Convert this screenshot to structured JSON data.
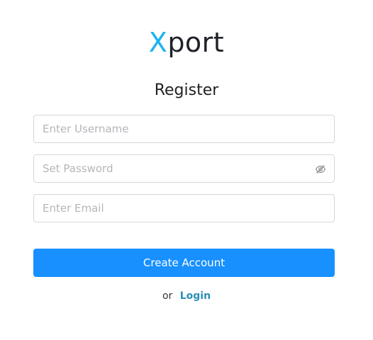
{
  "brand": {
    "accent_letter": "X",
    "rest": "port"
  },
  "form": {
    "title": "Register",
    "username": {
      "placeholder": "Enter Username",
      "value": ""
    },
    "password": {
      "placeholder": "Set Password",
      "value": "",
      "toggle_icon": "eye-slash-icon"
    },
    "email": {
      "placeholder": "Enter Email",
      "value": ""
    },
    "submit_label": "Create Account"
  },
  "footer": {
    "or_text": "or",
    "login_label": "Login"
  },
  "colors": {
    "accent": "#1ab3f0",
    "primary": "#1890ff",
    "link": "#2a8fb8"
  }
}
